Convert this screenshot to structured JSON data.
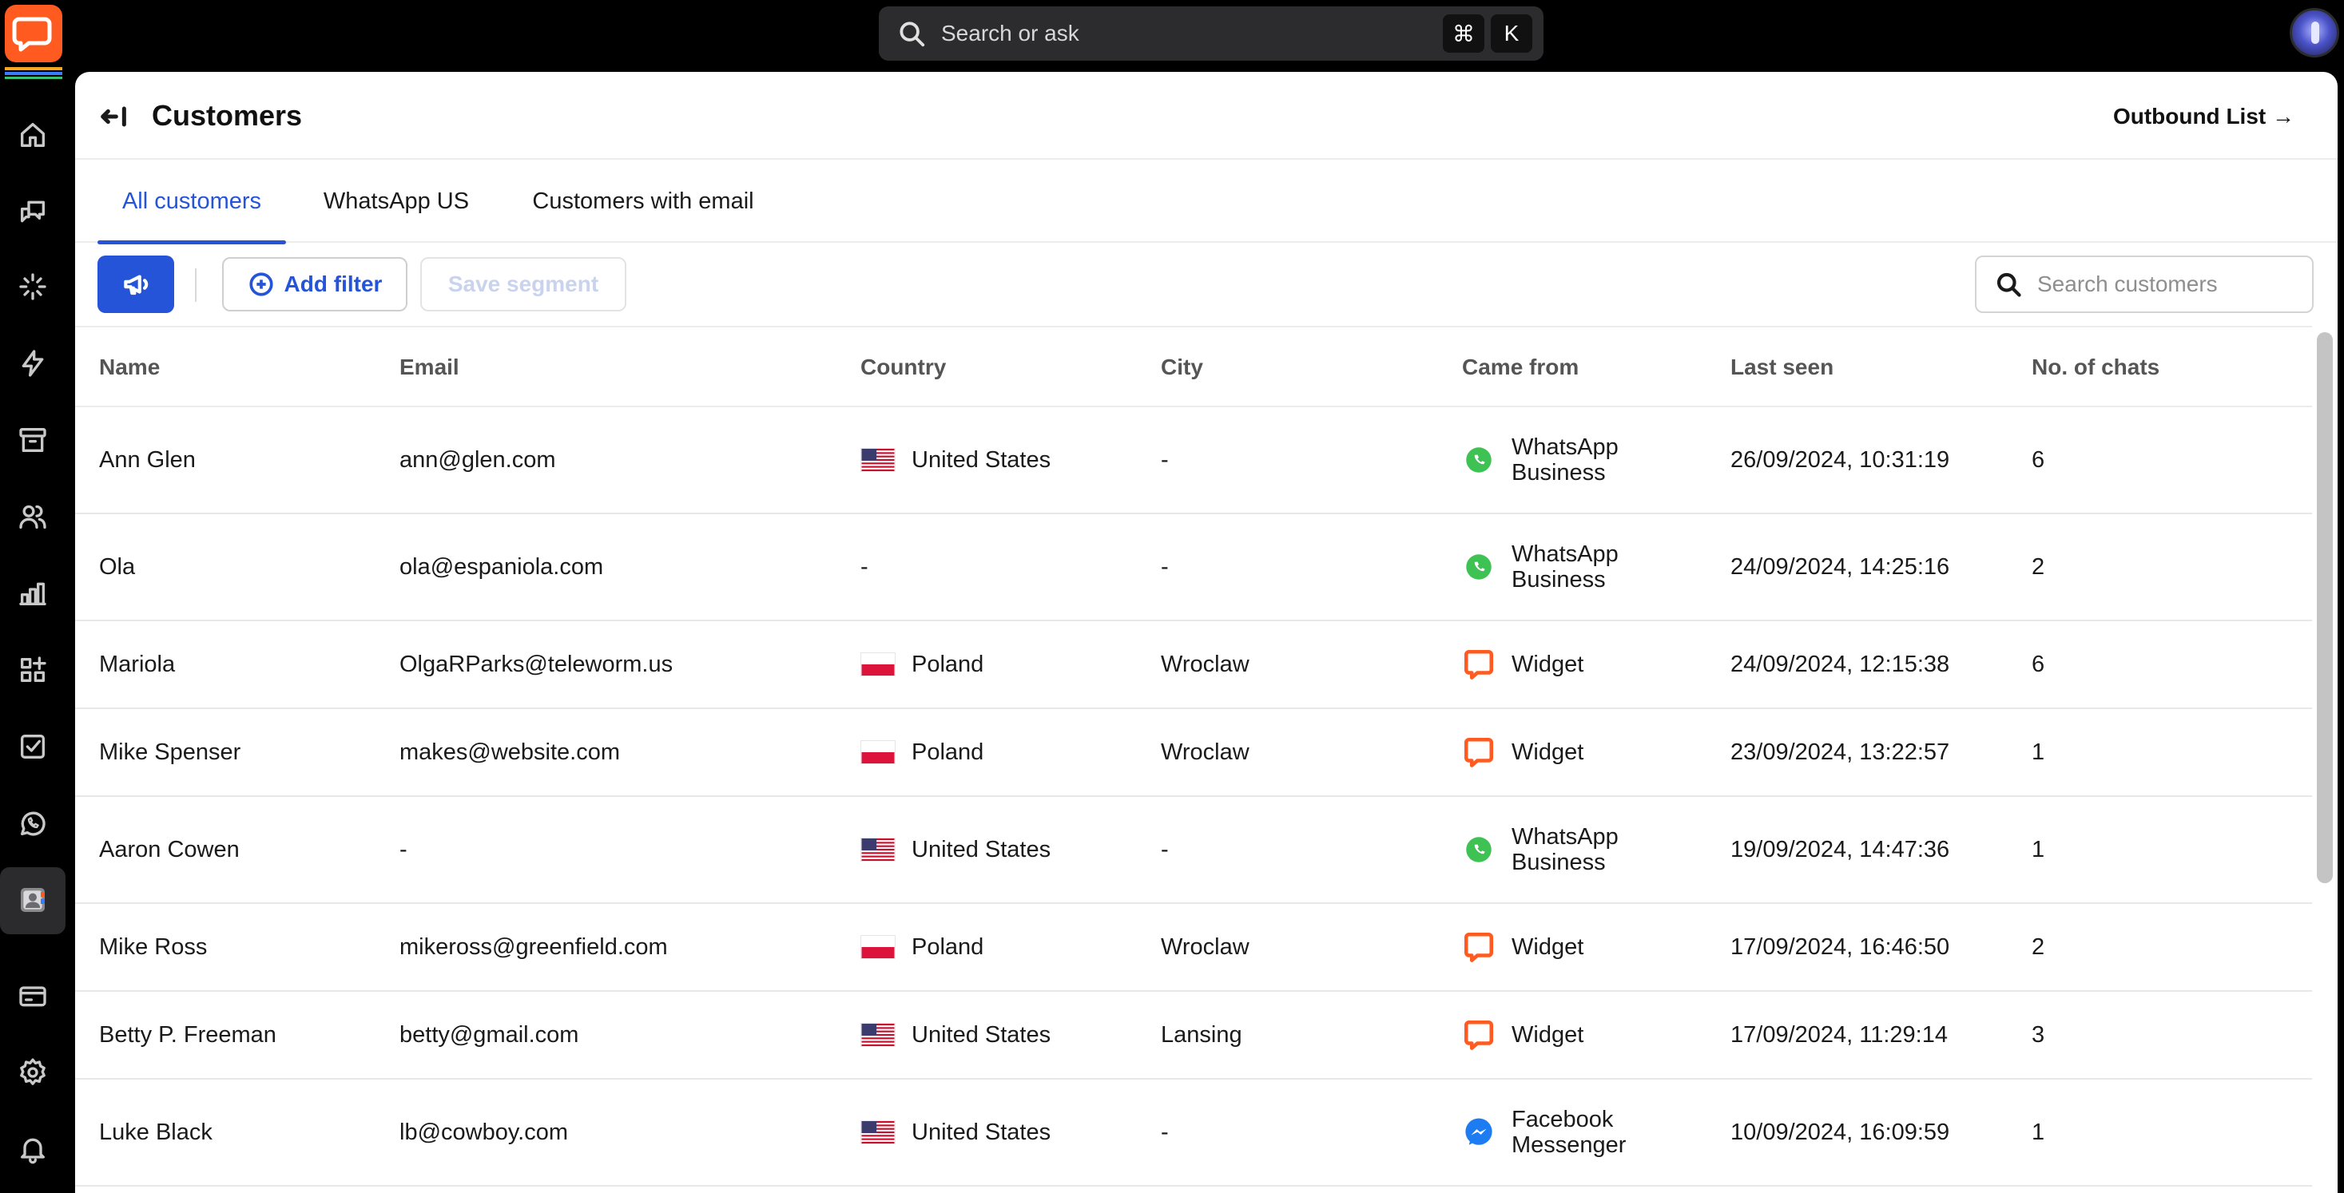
{
  "topbar": {
    "search_label": "Search or ask",
    "shortcut_keys": [
      "⌘",
      "K"
    ]
  },
  "header": {
    "title": "Customers",
    "outbound_link": "Outbound List →"
  },
  "tabs": [
    {
      "label": "All customers",
      "active": true
    },
    {
      "label": "WhatsApp US",
      "active": false
    },
    {
      "label": "Customers with email",
      "active": false
    }
  ],
  "toolbar": {
    "add_filter_label": "Add filter",
    "save_segment_label": "Save segment",
    "search_placeholder": "Search customers"
  },
  "table": {
    "columns": [
      "Name",
      "Email",
      "Country",
      "City",
      "Came from",
      "Last seen",
      "No. of chats"
    ],
    "rows": [
      {
        "name": "Ann Glen",
        "email": "ann@glen.com",
        "country": "United States",
        "flag": "us",
        "city": "-",
        "source": "WhatsApp Business",
        "source_icon": "whatsapp-icon",
        "last_seen": "26/09/2024, 10:31:19",
        "chats": "6"
      },
      {
        "name": "Ola",
        "email": "ola@espaniola.com",
        "country": "-",
        "flag": "",
        "city": "-",
        "source": "WhatsApp Business",
        "source_icon": "whatsapp-icon",
        "last_seen": "24/09/2024, 14:25:16",
        "chats": "2"
      },
      {
        "name": "Mariola",
        "email": "OlgaRParks@teleworm.us",
        "country": "Poland",
        "flag": "pl",
        "city": "Wroclaw",
        "source": "Widget",
        "source_icon": "widget-icon",
        "last_seen": "24/09/2024, 12:15:38",
        "chats": "6"
      },
      {
        "name": "Mike Spenser",
        "email": "makes@website.com",
        "country": "Poland",
        "flag": "pl",
        "city": "Wroclaw",
        "source": "Widget",
        "source_icon": "widget-icon",
        "last_seen": "23/09/2024, 13:22:57",
        "chats": "1"
      },
      {
        "name": "Aaron Cowen",
        "email": "-",
        "country": "United States",
        "flag": "us",
        "city": "-",
        "source": "WhatsApp Business",
        "source_icon": "whatsapp-icon",
        "last_seen": "19/09/2024, 14:47:36",
        "chats": "1"
      },
      {
        "name": "Mike Ross",
        "email": "mikeross@greenfield.com",
        "country": "Poland",
        "flag": "pl",
        "city": "Wroclaw",
        "source": "Widget",
        "source_icon": "widget-icon",
        "last_seen": "17/09/2024, 16:46:50",
        "chats": "2"
      },
      {
        "name": "Betty P. Freeman",
        "email": "betty@gmail.com",
        "country": "United States",
        "flag": "us",
        "city": "Lansing",
        "source": "Widget",
        "source_icon": "widget-icon",
        "last_seen": "17/09/2024, 11:29:14",
        "chats": "3"
      },
      {
        "name": "Luke Black",
        "email": "lb@cowboy.com",
        "country": "United States",
        "flag": "us",
        "city": "-",
        "source": "Facebook Messenger",
        "source_icon": "messenger-icon",
        "last_seen": "10/09/2024, 16:09:59",
        "chats": "1"
      }
    ]
  },
  "colors": {
    "accent": "#2554d8",
    "brand": "#ff5a1f",
    "whatsapp": "#3fc254",
    "messenger": "#1e7cf2"
  }
}
